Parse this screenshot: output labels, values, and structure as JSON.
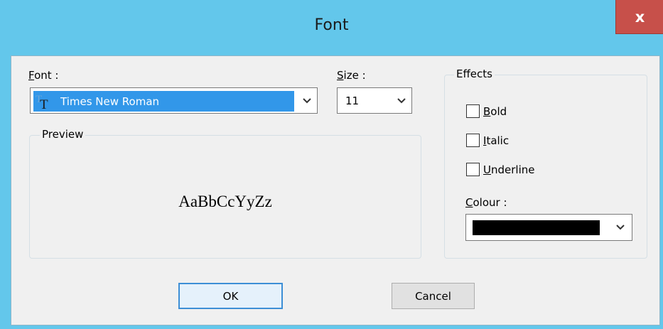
{
  "window": {
    "title": "Font",
    "close_label": "x"
  },
  "font": {
    "label_prefix": "",
    "label_mnemonic": "F",
    "label_rest": "ont :",
    "selected": "Times New Roman",
    "icon": "truetype-font-icon"
  },
  "size": {
    "label_mnemonic": "S",
    "label_rest": "ize :",
    "selected": "11"
  },
  "preview": {
    "legend": "Preview",
    "sample": "AaBbCcYyZz"
  },
  "effects": {
    "legend": "Effects",
    "options": [
      {
        "mnemonic": "B",
        "rest": "old",
        "checked": false
      },
      {
        "mnemonic": "I",
        "rest": "talic",
        "checked": false
      },
      {
        "mnemonic": "U",
        "rest": "nderline",
        "checked": false
      }
    ],
    "colour_label_mnemonic": "C",
    "colour_label_rest": "olour :",
    "colour_value": "#000000"
  },
  "buttons": {
    "ok": "OK",
    "cancel": "Cancel"
  },
  "colors": {
    "titlebar": "#63c7eb",
    "close": "#c7504a",
    "selection": "#3297e9",
    "dialog_bg": "#f0f0f0"
  }
}
